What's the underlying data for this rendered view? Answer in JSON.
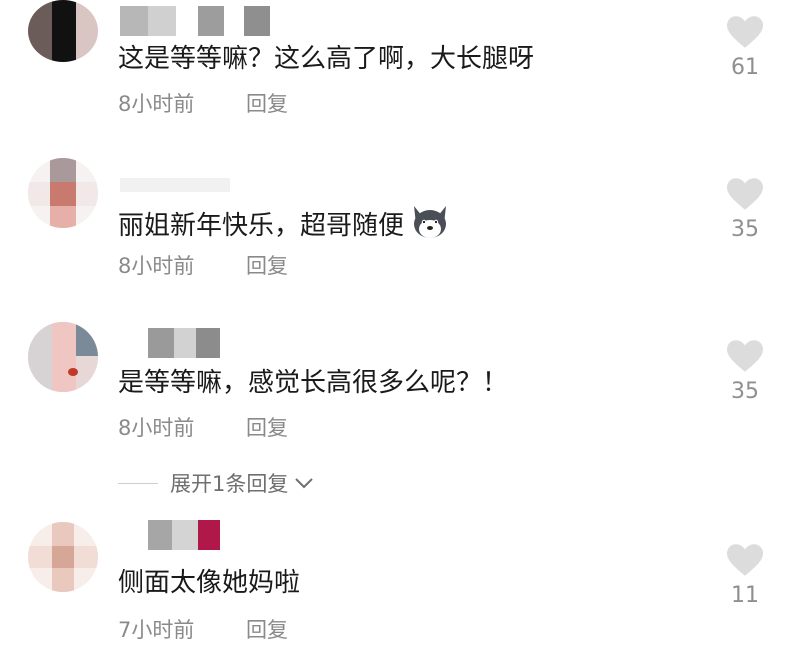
{
  "comments": [
    {
      "text": "这是等等嘛？这么高了啊，大长腿呀",
      "time": "8小时前",
      "reply": "回复",
      "likes": "61",
      "avatar_colors": [
        "#6b5b59",
        "#111111",
        "#b89a91",
        "#d9c6c3"
      ],
      "name_blocks": [
        "#b7b7b7",
        "#d0d0d0",
        "#9d9d9d",
        "#8f8f8f"
      ]
    },
    {
      "text": "丽姐新年快乐，超哥随便",
      "emoji": "husky-dog-emoji",
      "time": "8小时前",
      "reply": "回复",
      "likes": "35",
      "avatar_colors": [
        "#a9999a",
        "#c97a6e",
        "#e6b0a8"
      ],
      "name_blocks": [
        "#e8e8e8",
        "#dcdcdc"
      ]
    },
    {
      "text": "是等等嘛，感觉长高很多么呢？！",
      "time": "8小时前",
      "reply": "回复",
      "likes": "35",
      "avatar_colors": [
        "#d7d3d4",
        "#f0c6c2",
        "#7b8a98",
        "#c0392b"
      ],
      "name_blocks": [
        "#9a9a9a",
        "#d2d2d2",
        "#8c8c8c"
      ]
    },
    {
      "text": "侧面太像她妈啦",
      "time": "7小时前",
      "reply": "回复",
      "likes": "11",
      "avatar_colors": [
        "#e9c9be",
        "#f2ddd6",
        "#d6a796"
      ],
      "name_blocks": [
        "#a6a6a6",
        "#d4d4d4",
        "#b0184a"
      ]
    }
  ],
  "expand_replies": "展开1条回复",
  "colors": {
    "like_icon": "#dcdcdc",
    "meta_text": "#8a8a8a"
  }
}
